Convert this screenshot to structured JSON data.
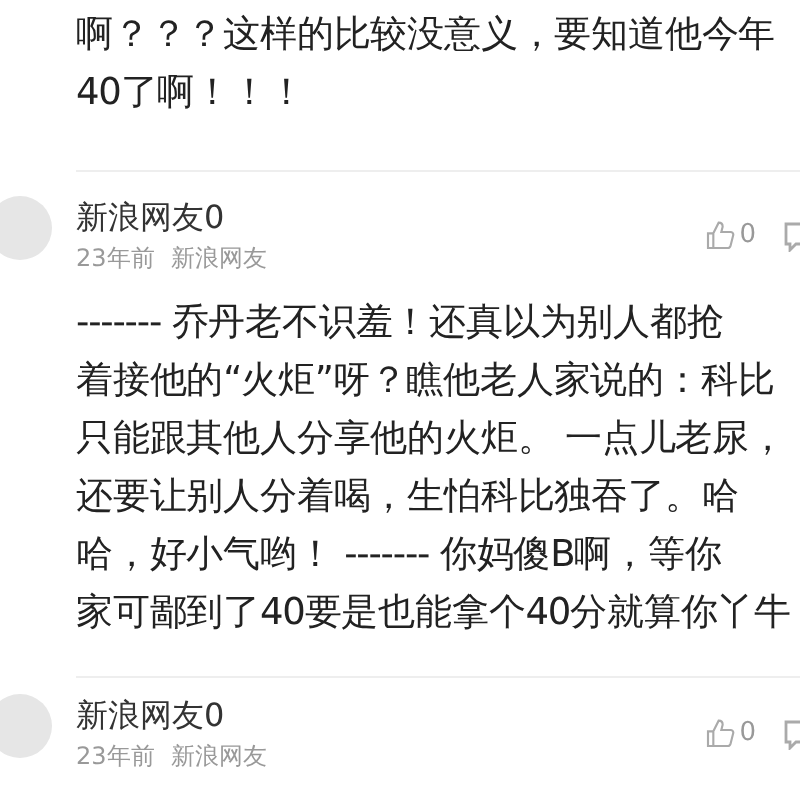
{
  "top_comment": {
    "lines": [
      "啊？？？这样的比较没意义，要知道他今年",
      "40了啊！！！"
    ]
  },
  "comments": [
    {
      "user": "新浪网友0",
      "time": "23年前",
      "source": "新浪网友",
      "likes": "0",
      "lines": [
        "------- 乔丹老不识羞！还真以为别人都抢",
        "着接他的“火炬”呀？瞧他老人家说的：科比",
        "只能跟其他人分享他的火炬。 一点儿老尿，",
        "还要让别人分着喝，生怕科比独吞了。哈",
        "哈，好小气哟！ ------- 你妈傻B啊，等你",
        "家可鄙到了40要是也能拿个40分就算你丫牛"
      ]
    },
    {
      "user": "新浪网友0",
      "time": "23年前",
      "source": "新浪网友",
      "likes": "0"
    }
  ]
}
